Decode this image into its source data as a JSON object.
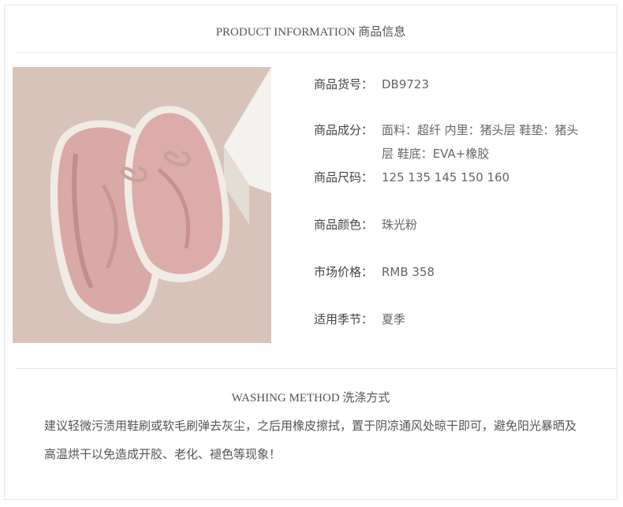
{
  "header": {
    "title": "PRODUCT INFORMATION 商品信息"
  },
  "product": {
    "image_alt": "product-photo",
    "rows": [
      {
        "label": "商品货号：",
        "value": "DB9723"
      },
      {
        "label": "商品成分：",
        "value": "面料：超纤 内里：猪头层 鞋垫：猪头层 鞋底：EVA+橡胶"
      },
      {
        "label": "商品尺码：",
        "value": "125 135 145 150 160"
      },
      {
        "label": "商品颜色：",
        "value": "珠光粉"
      },
      {
        "label": "市场价格：",
        "value": "RMB 358"
      },
      {
        "label": "适用季节：",
        "value": "夏季"
      }
    ]
  },
  "washing": {
    "title": "WASHING METHOD 洗涤方式",
    "text": "建议轻微污渍用鞋刷或软毛刷弹去灰尘，之后用橡皮擦拭，置于阴凉通风处晾干即可，避免阳光暴晒及高温烘干以免造成开胶、老化、褪色等现象！"
  }
}
